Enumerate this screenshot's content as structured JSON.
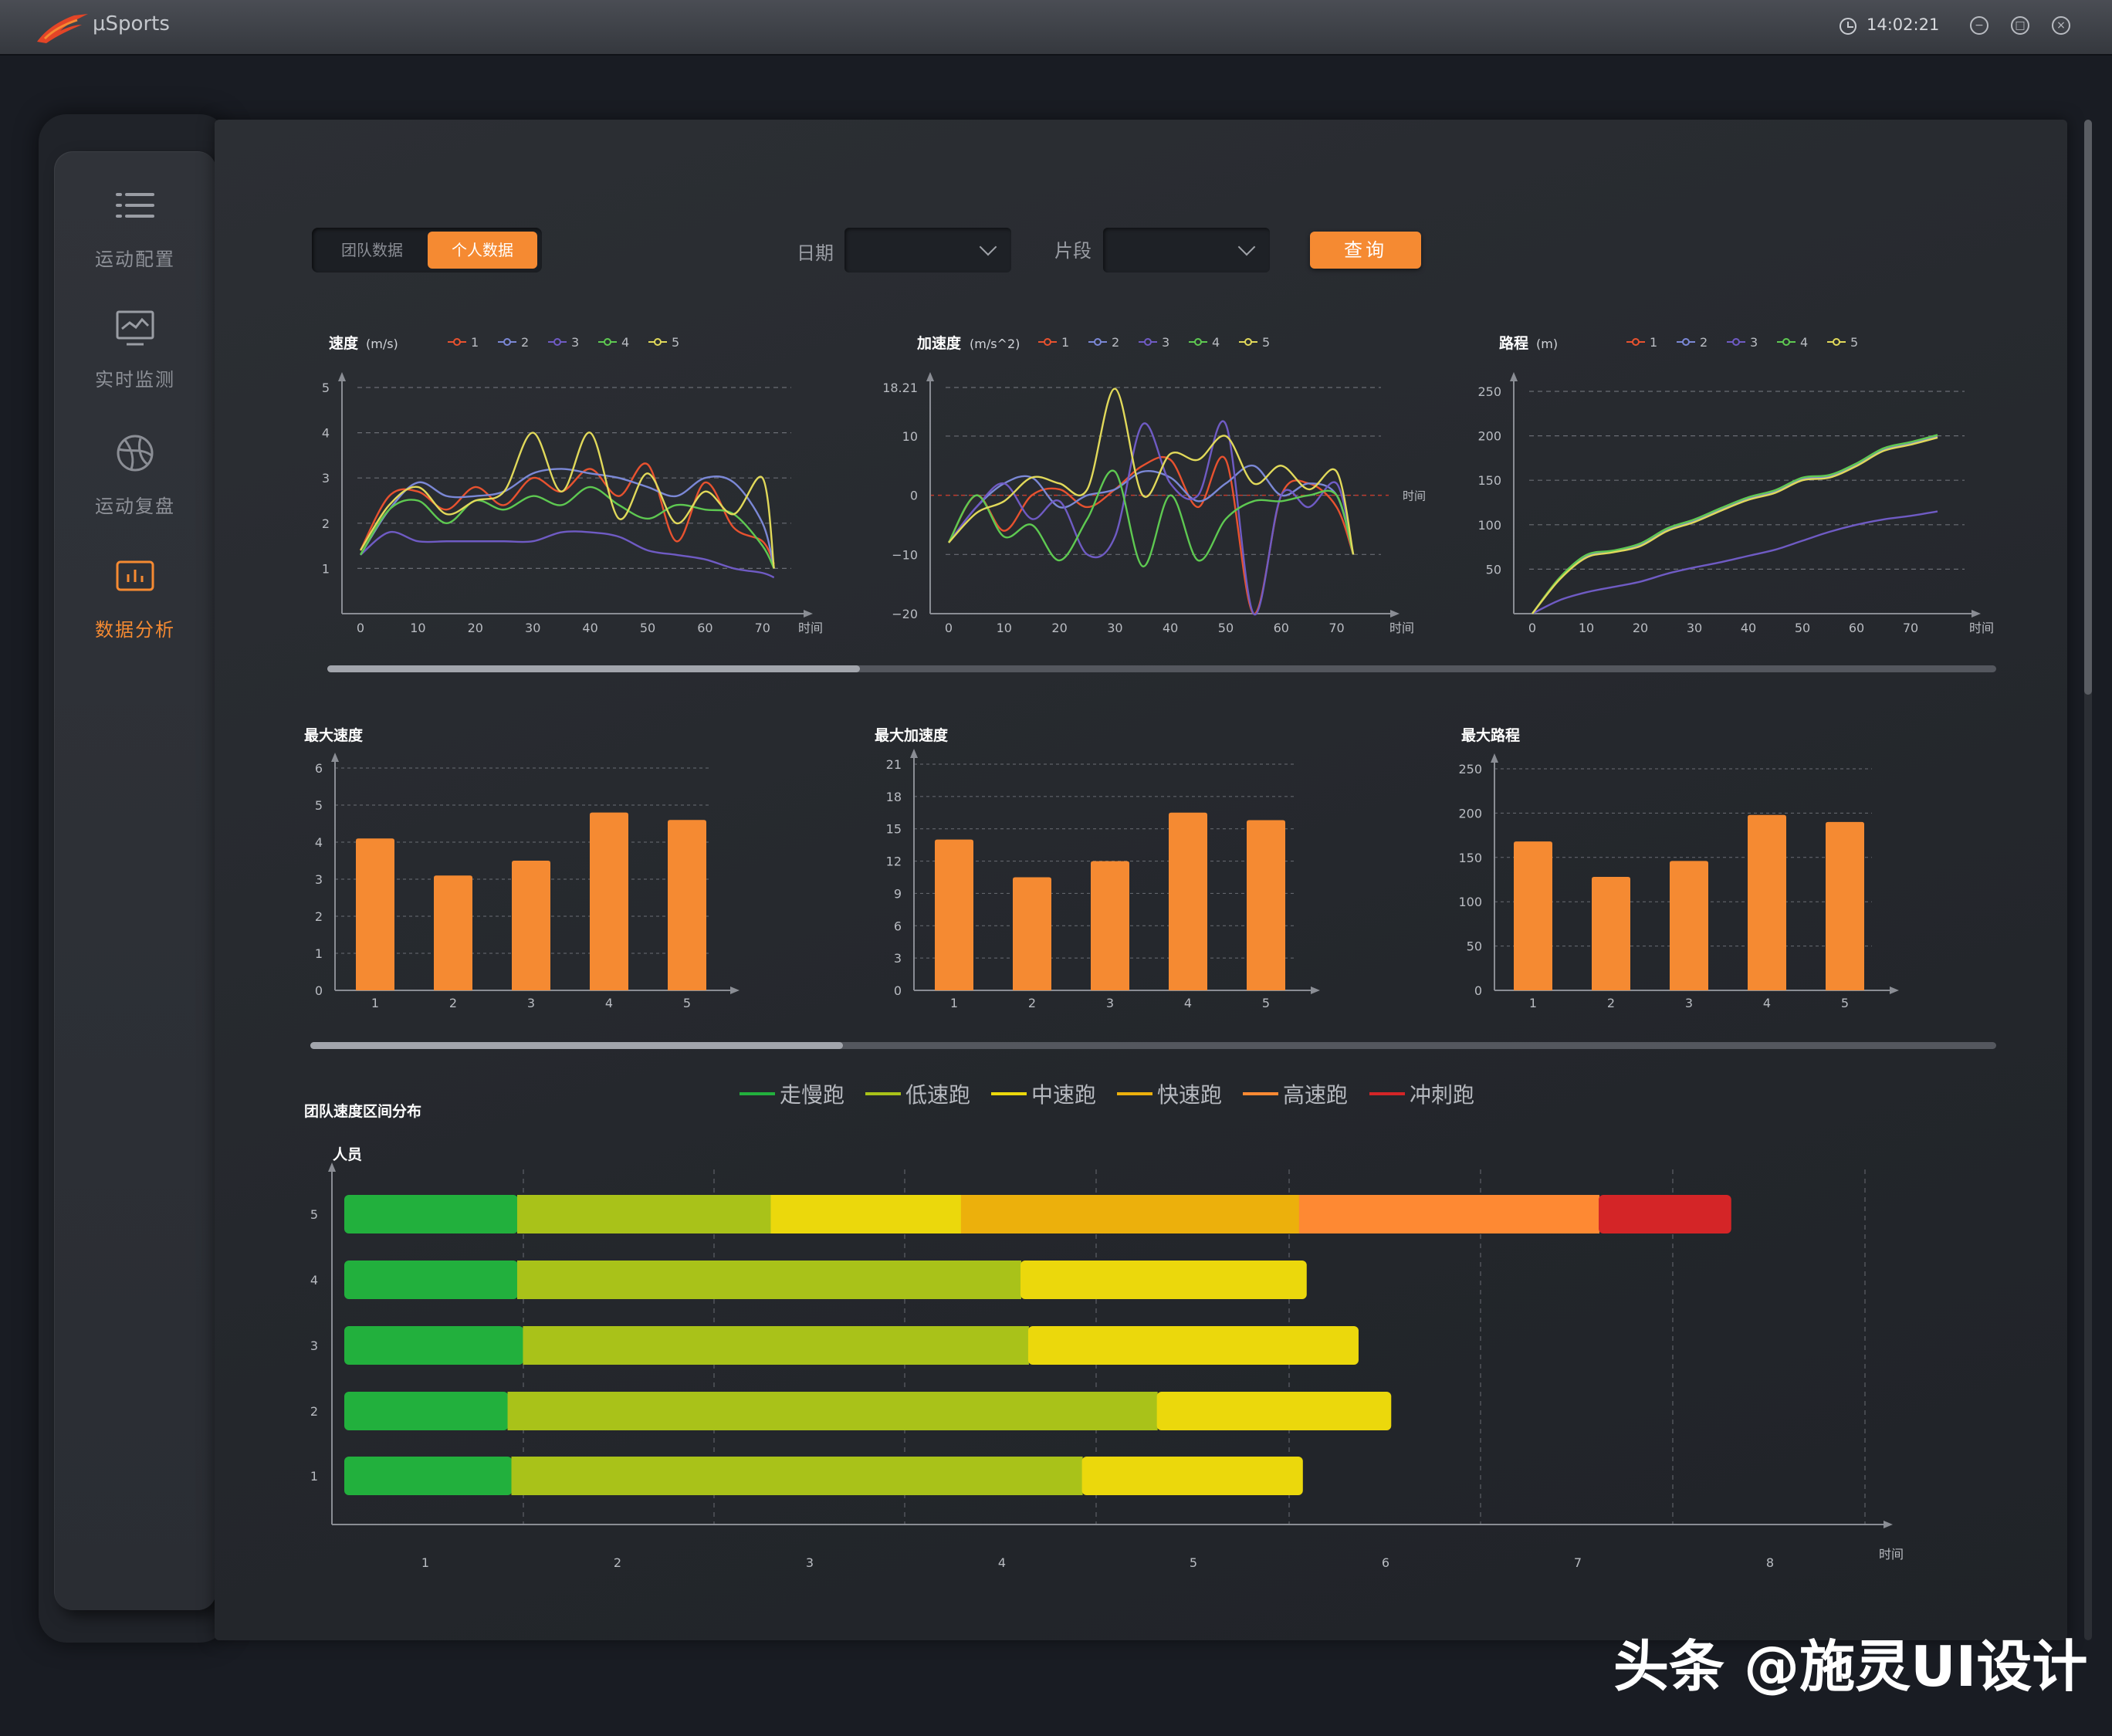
{
  "app": {
    "name": "μSports",
    "time": "14:02:21"
  },
  "nav": [
    {
      "label": "运动配置",
      "icon": "list-icon"
    },
    {
      "label": "实时监测",
      "icon": "monitor-icon"
    },
    {
      "label": "运动复盘",
      "icon": "basketball-icon"
    },
    {
      "label": "数据分析",
      "icon": "bar-chart-icon",
      "active": true
    }
  ],
  "filters": {
    "tab_team": "团队数据",
    "tab_personal": "个人数据",
    "date_label": "日期",
    "date_value": "",
    "segment_label": "片段",
    "segment_value": "",
    "query_button": "查询"
  },
  "colors": {
    "accent": "#f58a32",
    "series": [
      "#e8522f",
      "#7b88d6",
      "#6f5bc4",
      "#5ec951",
      "#e1d95a"
    ]
  },
  "chart_data": [
    {
      "type": "line",
      "title": "速度",
      "unit": "(m/s)",
      "xlabel": "时间",
      "x": [
        0,
        5,
        10,
        15,
        20,
        25,
        30,
        35,
        40,
        45,
        50,
        55,
        60,
        65,
        70,
        72
      ],
      "xlim": [
        0,
        75
      ],
      "ylim": [
        0,
        5
      ],
      "xticks": [
        "0",
        "10",
        "20",
        "30",
        "40",
        "50",
        "60",
        "70"
      ],
      "yticks": [
        "0",
        "1",
        "2",
        "3",
        "4",
        "5"
      ],
      "series": [
        {
          "name": "1",
          "values": [
            1.4,
            2.6,
            2.7,
            2.3,
            2.8,
            2.4,
            3.0,
            2.7,
            3.2,
            2.6,
            3.3,
            1.6,
            2.9,
            1.9,
            1.6,
            1.1
          ]
        },
        {
          "name": "2",
          "values": [
            1.3,
            2.3,
            2.9,
            2.6,
            2.6,
            2.7,
            3.1,
            3.2,
            3.1,
            3.0,
            2.8,
            2.6,
            3.0,
            2.9,
            2.0,
            1.0
          ]
        },
        {
          "name": "3",
          "values": [
            1.3,
            1.8,
            1.6,
            1.6,
            1.6,
            1.6,
            1.6,
            1.8,
            1.8,
            1.7,
            1.4,
            1.3,
            1.2,
            1.0,
            0.9,
            0.8
          ]
        },
        {
          "name": "4",
          "values": [
            1.3,
            2.3,
            2.5,
            2.0,
            2.5,
            2.3,
            2.6,
            2.4,
            2.8,
            2.4,
            2.1,
            2.4,
            2.3,
            2.2,
            1.5,
            1.0
          ]
        },
        {
          "name": "5",
          "values": [
            1.4,
            2.4,
            2.8,
            2.2,
            2.5,
            2.7,
            4.0,
            2.7,
            4.0,
            2.1,
            3.1,
            2.0,
            2.7,
            2.2,
            3.0,
            1.0
          ]
        }
      ]
    },
    {
      "type": "line",
      "title": "加速度",
      "unit": "(m/s^2)",
      "xlabel": "时间",
      "x": [
        0,
        5,
        10,
        15,
        20,
        25,
        30,
        35,
        40,
        45,
        50,
        55,
        60,
        65,
        70,
        73
      ],
      "xlim": [
        0,
        78
      ],
      "ylim": [
        -20,
        18.21
      ],
      "xticks": [
        "0",
        "10",
        "20",
        "30",
        "40",
        "50",
        "60",
        "70"
      ],
      "yticks": [
        "−20",
        "−10",
        "0",
        "10",
        "18.21"
      ],
      "series": [
        {
          "name": "1",
          "values": [
            -8,
            0,
            -6,
            0,
            1,
            -2,
            1,
            5,
            6,
            -2,
            6,
            -20,
            0,
            2,
            -2,
            -10
          ]
        },
        {
          "name": "2",
          "values": [
            -8,
            -2,
            2,
            3,
            -2,
            0,
            1,
            4,
            3,
            -1,
            2,
            5,
            0,
            2,
            0,
            -10
          ]
        },
        {
          "name": "3",
          "values": [
            -8,
            -2,
            2,
            -4,
            -1,
            -10,
            -7,
            12,
            2,
            0,
            12,
            -20,
            0,
            -2,
            2,
            -10
          ]
        },
        {
          "name": "4",
          "values": [
            -8,
            0,
            -7,
            -5,
            -11,
            -4,
            4,
            -12,
            0,
            -11,
            -4,
            -1,
            -1,
            0,
            0,
            -10
          ]
        },
        {
          "name": "5",
          "values": [
            -8,
            -3,
            -1,
            3,
            2,
            1,
            18,
            0,
            7,
            6,
            10,
            2,
            5,
            1,
            4,
            -10
          ]
        }
      ]
    },
    {
      "type": "line",
      "title": "路程",
      "unit": "(m)",
      "xlabel": "时间",
      "x": [
        0,
        5,
        10,
        15,
        20,
        25,
        30,
        35,
        40,
        45,
        50,
        55,
        60,
        65,
        70,
        75
      ],
      "xlim": [
        0,
        80
      ],
      "ylim": [
        0,
        250
      ],
      "xticks": [
        "0",
        "10",
        "20",
        "30",
        "40",
        "50",
        "60",
        "70"
      ],
      "yticks": [
        "0",
        "50",
        "100",
        "150",
        "200",
        "250"
      ],
      "series": [
        {
          "name": "1",
          "values": [
            0,
            40,
            65,
            70,
            78,
            95,
            105,
            118,
            130,
            138,
            152,
            155,
            168,
            185,
            192,
            200
          ]
        },
        {
          "name": "2",
          "values": [
            0,
            39,
            64,
            70,
            77,
            94,
            104,
            117,
            129,
            137,
            151,
            154,
            167,
            184,
            191,
            199
          ]
        },
        {
          "name": "3",
          "values": [
            0,
            15,
            24,
            30,
            36,
            45,
            52,
            58,
            65,
            72,
            82,
            92,
            100,
            106,
            110,
            115
          ]
        },
        {
          "name": "4",
          "values": [
            0,
            40,
            66,
            71,
            79,
            96,
            106,
            119,
            131,
            139,
            153,
            156,
            169,
            186,
            193,
            201
          ]
        },
        {
          "name": "5",
          "values": [
            0,
            38,
            63,
            69,
            76,
            93,
            103,
            116,
            128,
            136,
            150,
            153,
            166,
            183,
            190,
            198
          ]
        }
      ]
    },
    {
      "type": "bar",
      "title": "最大速度",
      "categories": [
        "1",
        "2",
        "3",
        "4",
        "5"
      ],
      "values": [
        4.1,
        3.1,
        3.5,
        4.8,
        4.6
      ],
      "ylim": [
        0,
        6
      ],
      "yticks": [
        "0",
        "1",
        "2",
        "3",
        "4",
        "5",
        "6"
      ]
    },
    {
      "type": "bar",
      "title": "最大加速度",
      "categories": [
        "1",
        "2",
        "3",
        "4",
        "5"
      ],
      "values": [
        14,
        10.5,
        12,
        16.5,
        15.8
      ],
      "ylim": [
        0,
        21
      ],
      "yticks": [
        "0",
        "3",
        "6",
        "9",
        "12",
        "15",
        "18",
        "21"
      ]
    },
    {
      "type": "bar",
      "title": "最大路程",
      "categories": [
        "1",
        "2",
        "3",
        "4",
        "5"
      ],
      "values": [
        168,
        128,
        146,
        198,
        190
      ],
      "ylim": [
        0,
        250
      ],
      "yticks": [
        "0",
        "50",
        "100",
        "150",
        "200",
        "250"
      ]
    },
    {
      "type": "bar",
      "title": "团队速度区间分布",
      "orientation": "horizontal",
      "stacked": true,
      "ylabel": "人员",
      "xlabel": "时间",
      "categories": [
        "5",
        "4",
        "3",
        "2",
        "1"
      ],
      "xticks": [
        "1",
        "2",
        "3",
        "4",
        "5",
        "6",
        "7",
        "8"
      ],
      "xlim": [
        0.6,
        8.5
      ],
      "series": [
        {
          "name": "走慢跑",
          "color": "#22b03d",
          "values": [
            0.9,
            0.9,
            0.93,
            0.85,
            0.87
          ]
        },
        {
          "name": "低速跑",
          "color": "#a9c219",
          "values": [
            1.32,
            2.62,
            2.63,
            3.38,
            2.97
          ]
        },
        {
          "name": "中速跑",
          "color": "#ebd80c",
          "values": [
            0.99,
            1.49,
            1.72,
            1.22,
            1.15
          ]
        },
        {
          "name": "快速跑",
          "color": "#ecb00c",
          "values": [
            1.76,
            0,
            0,
            0,
            0
          ]
        },
        {
          "name": "高速跑",
          "color": "#fe8933",
          "values": [
            1.56,
            0,
            0,
            0,
            0
          ]
        },
        {
          "name": "冲刺跑",
          "color": "#d42527",
          "values": [
            0.69,
            0,
            0,
            0,
            0
          ]
        }
      ]
    }
  ],
  "watermark": "头条 @施灵UI设计"
}
